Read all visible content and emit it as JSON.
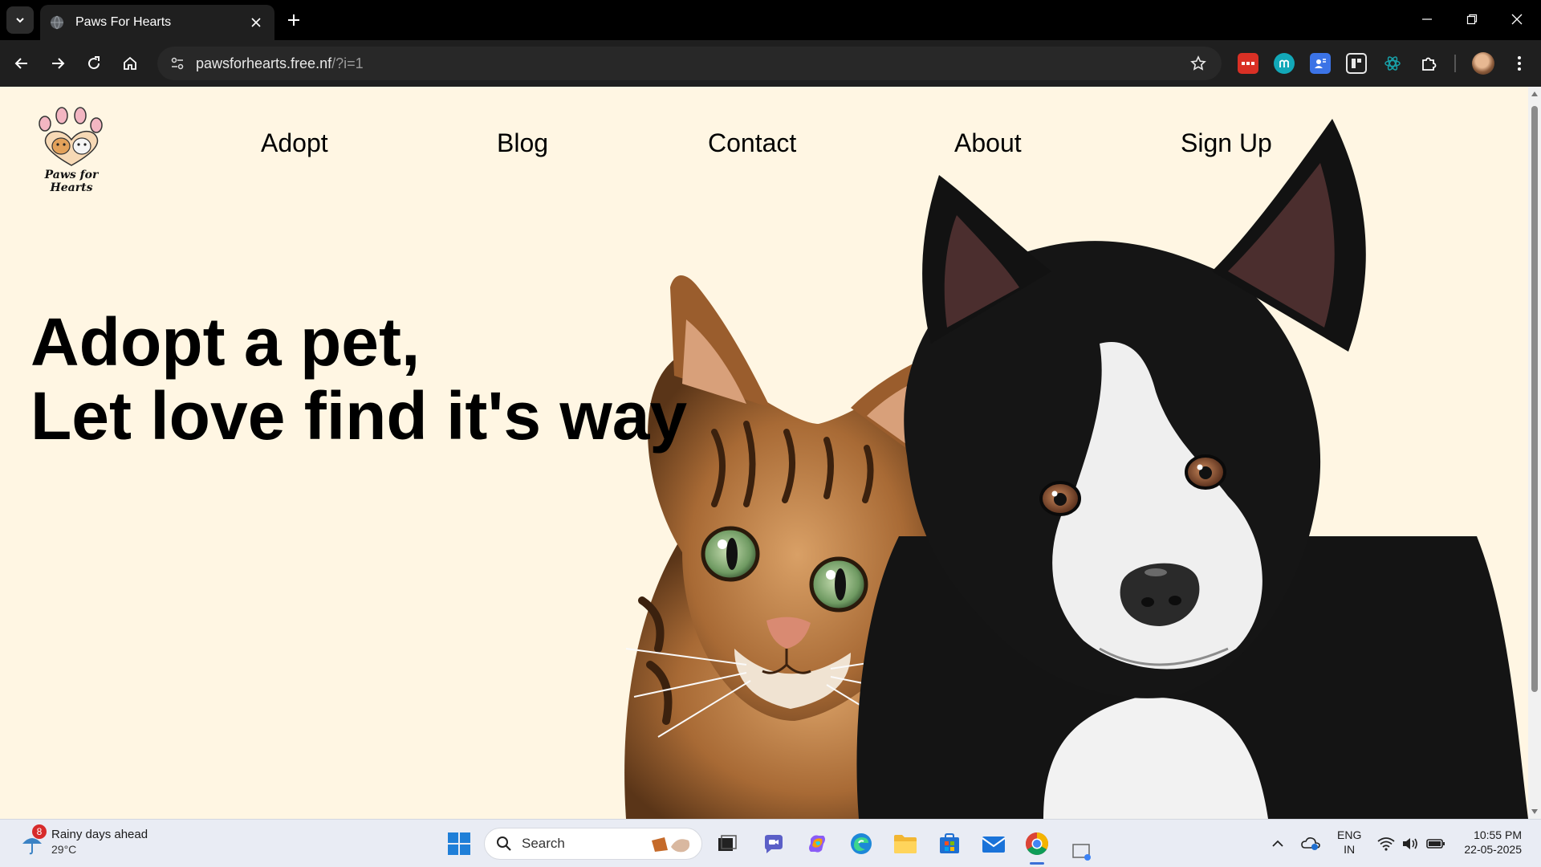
{
  "browser": {
    "tab_title": "Paws For Hearts",
    "url_host": "pawsforhearts.free.nf",
    "url_path": "/?i=1",
    "extensions": [
      "todo-extension-icon",
      "m-extension-icon",
      "contact-extension-icon",
      "toggle-extension-icon",
      "atom-extension-icon",
      "puzzle-extensions-icon"
    ],
    "colors": {
      "tabbar": "#000000",
      "toolbar": "#1f1f1f",
      "omnibox": "#282828"
    }
  },
  "site": {
    "logo_text": "Paws for Hearts",
    "nav": [
      "Adopt",
      "Blog",
      "Contact",
      "About",
      "Sign Up"
    ],
    "hero_line1": "Adopt a pet,",
    "hero_line2": "Let love find it's way",
    "colors": {
      "background": "#fff6e3",
      "text": "#000000"
    }
  },
  "taskbar": {
    "weather_badge": "8",
    "weather_title": "Rainy days ahead",
    "weather_temp": "29°C",
    "search_label": "Search",
    "lang_line1": "ENG",
    "lang_line2": "IN",
    "time": "10:55 PM",
    "date": "22-05-2025"
  }
}
